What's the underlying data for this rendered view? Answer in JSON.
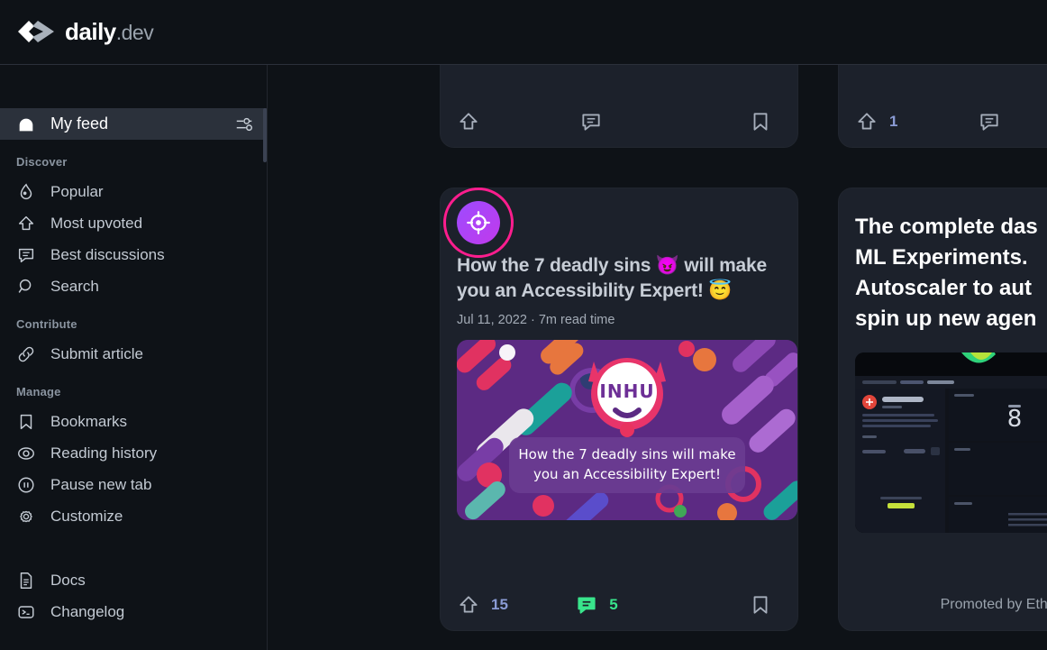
{
  "header": {
    "logo_name": "daily",
    "logo_suffix": ".dev"
  },
  "sidebar": {
    "my_feed": {
      "label": "My feed",
      "icon": "home-icon",
      "filter_icon": "sliders-icon"
    },
    "sections": [
      {
        "title": "Discover",
        "items": [
          {
            "label": "Popular",
            "icon": "flame-icon"
          },
          {
            "label": "Most upvoted",
            "icon": "upvote-icon"
          },
          {
            "label": "Best discussions",
            "icon": "comment-icon"
          },
          {
            "label": "Search",
            "icon": "search-icon"
          }
        ]
      },
      {
        "title": "Contribute",
        "items": [
          {
            "label": "Submit article",
            "icon": "link-icon"
          }
        ]
      },
      {
        "title": "Manage",
        "items": [
          {
            "label": "Bookmarks",
            "icon": "bookmark-icon"
          },
          {
            "label": "Reading history",
            "icon": "eye-icon"
          },
          {
            "label": "Pause new tab",
            "icon": "pause-icon"
          },
          {
            "label": "Customize",
            "icon": "gear-icon"
          }
        ]
      }
    ],
    "footer_items": [
      {
        "label": "Docs",
        "icon": "document-icon"
      },
      {
        "label": "Changelog",
        "icon": "terminal-icon"
      }
    ]
  },
  "feed": {
    "cards": {
      "top_left": {
        "upvotes": "",
        "comments": "",
        "upvote_icon": "upvote-icon",
        "comment_icon": "comment-icon",
        "bookmark_icon": "bookmark-icon"
      },
      "top_right": {
        "upvotes": "1",
        "comments": "",
        "upvote_icon": "upvote-icon",
        "comment_icon": "comment-icon"
      },
      "article": {
        "source_icon": "target-crosshair-icon",
        "title": "How the 7 deadly sins 😈 will make you an Accessibility Expert! 😇",
        "date": "Jul 11, 2022",
        "separator": "·",
        "read_time": "7m read time",
        "meta": "Jul 11, 2022 · 7m read time",
        "thumbnail_brand": "INHU",
        "thumbnail_caption_line1": "How the 7 deadly sins will make",
        "thumbnail_caption_line2": "you an Accessibility Expert!",
        "upvotes": "15",
        "comments": "5",
        "upvote_icon": "upvote-icon",
        "comment_icon": "comment-icon",
        "bookmark_icon": "bookmark-icon"
      },
      "ad": {
        "title_lines": [
          "The complete das",
          "ML Experiments.",
          "Autoscaler to aut",
          "spin up new agen"
        ],
        "promoted_label": "Promoted by EthicalAds",
        "image_metric": "8"
      }
    }
  },
  "colors": {
    "page_bg": "#0e1217",
    "card_bg": "#1c212b",
    "sidebar_active": "#2b313b",
    "accent_pink": "#ff1d8e",
    "accent_green": "#39e58c",
    "upvote_blue": "#8a9bd4",
    "source_gradient_from": "#9d4bff",
    "source_gradient_to": "#c13aeb"
  }
}
